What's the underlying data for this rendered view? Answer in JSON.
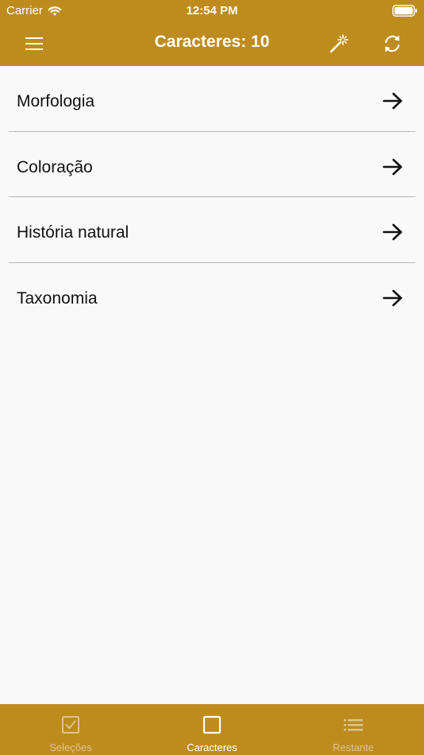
{
  "status_bar": {
    "carrier": "Carrier",
    "time": "12:54 PM"
  },
  "nav": {
    "title": "Caracteres: 10",
    "icons": [
      "menu-icon",
      "magic-wand-icon",
      "refresh-icon"
    ]
  },
  "list": {
    "items": [
      {
        "label": "Morfologia"
      },
      {
        "label": "Coloração"
      },
      {
        "label": "História natural"
      },
      {
        "label": "Taxonomia"
      }
    ]
  },
  "tab_bar": {
    "tabs": [
      {
        "label": "Seleções",
        "icon": "checkbox-checked-icon",
        "active": false
      },
      {
        "label": "Caracteres",
        "icon": "square-icon",
        "active": true
      },
      {
        "label": "Restante",
        "icon": "list-icon",
        "active": false
      }
    ]
  },
  "colors": {
    "brand": "#be8c1e",
    "background": "#f9f9f9",
    "tab_inactive": "#dcc38f",
    "tab_active": "#ffffff"
  }
}
